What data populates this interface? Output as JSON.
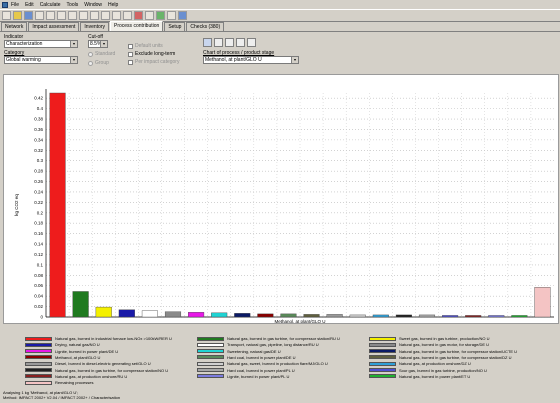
{
  "menu": [
    "File",
    "Edit",
    "Calculate",
    "Tools",
    "Window",
    "Help"
  ],
  "tabs": [
    {
      "label": "Network",
      "active": false
    },
    {
      "label": "Impact assessment",
      "active": false
    },
    {
      "label": "Inventory",
      "active": false
    },
    {
      "label": "Process contribution",
      "active": true
    },
    {
      "label": "Setup",
      "active": false
    },
    {
      "label": "Checks (380)",
      "active": false
    }
  ],
  "controls": {
    "indicator_label": "Indicator",
    "indicator_value": "Characterization",
    "category_label": "Category",
    "category_value": "Global warming",
    "cutoff_label": "Cut-off",
    "cutoff_value": "8.5%",
    "default_units": "Default units",
    "exclude_long_term": "Exclude long-term",
    "per_impact_category": "Per impact category",
    "standard": "Standard",
    "group": "Group",
    "chart_of_label": "Chart of process / product stage",
    "chart_of_value": "Methanol, at plant/GLO U"
  },
  "chart_data": {
    "type": "bar",
    "ylabel": "kg CO2 eq",
    "xlabel": "Methanol, at plant/GLO U",
    "ylim": [
      0,
      0.43
    ],
    "yticks": [
      0,
      0.02,
      0.04,
      0.06,
      0.08,
      0.1,
      0.12,
      0.14,
      0.16,
      0.18,
      0.2,
      0.22,
      0.24,
      0.26,
      0.28,
      0.3,
      0.32,
      0.34,
      0.36,
      0.38,
      0.4,
      0.42
    ],
    "bars": [
      {
        "name": "Natural gas, burned in industrial furnace low-NOx >100kW/RER U",
        "value": 0.43,
        "color": "#ee1c1c"
      },
      {
        "name": "Natural gas, burned in gas turbine, for compressor station/RU U",
        "value": 0.049,
        "color": "#1f7a1f"
      },
      {
        "name": "Sweet gas, burned in gas turbine, production/NO U",
        "value": 0.019,
        "color": "#f4f000"
      },
      {
        "name": "Drying, natural gas/NO U",
        "value": 0.014,
        "color": "#1a1aa8"
      },
      {
        "name": "Transport, natural gas, pipeline, long distance/RU U",
        "value": 0.012,
        "color": "#ffffff"
      },
      {
        "name": "Natural gas, burned in gas motor, for storage/DE U",
        "value": 0.01,
        "color": "#8a8a8a"
      },
      {
        "name": "Lignite, burned in power plant/DE U",
        "value": 0.009,
        "color": "#e818e8"
      },
      {
        "name": "Sweetening, natural gas/DE U",
        "value": 0.008,
        "color": "#20d4d4"
      },
      {
        "name": "Natural gas, burned in gas turbine, for compressor station/UCTE U",
        "value": 0.007,
        "color": "#0a1a66"
      },
      {
        "name": "Methanol, at plant/GLO U",
        "value": 0.006,
        "color": "#880000"
      },
      {
        "name": "Hard coal, burned in power plant/DE U",
        "value": 0.006,
        "color": "#5a8a5a"
      },
      {
        "name": "Natural gas, burned in gas turbine, for compressor station/DZ U",
        "value": 0.005,
        "color": "#606040"
      },
      {
        "name": "Diesel, burned in diesel-electric generating set/GLO U",
        "value": 0.005,
        "color": "#9a9a9a"
      },
      {
        "name": "Natural gas, sweet, burned in production flare/MJ/GLO U",
        "value": 0.004,
        "color": "#d0d0d0"
      },
      {
        "name": "Natural gas, at production onshore/DZ U",
        "value": 0.004,
        "color": "#30a0d8"
      },
      {
        "name": "Natural gas, burned in gas turbine, for compressor station/NO U",
        "value": 0.004,
        "color": "#202020"
      },
      {
        "name": "Hard coal, burned in power plant/PL U",
        "value": 0.004,
        "color": "#a8a8a8"
      },
      {
        "name": "Sour gas, burned in gas turbine, production/NO U",
        "value": 0.003,
        "color": "#5050d0"
      },
      {
        "name": "Natural gas, at production onshore/RU U",
        "value": 0.003,
        "color": "#882020"
      },
      {
        "name": "Lignite, burned in power plant/PL U",
        "value": 0.003,
        "color": "#7c7ce0"
      },
      {
        "name": "Natural gas, burned in power plant/ET U",
        "value": 0.003,
        "color": "#20b030"
      },
      {
        "name": "Remaining processes",
        "value": 0.057,
        "color": "#f4c4c4"
      }
    ]
  },
  "footer": {
    "line1": "Analysing 1 kg 'Methanol, at plant/GLO U';",
    "line2": "Method: IMPACT 2002+ V2.04 / IMPACT 2002+ / Characterisation"
  }
}
